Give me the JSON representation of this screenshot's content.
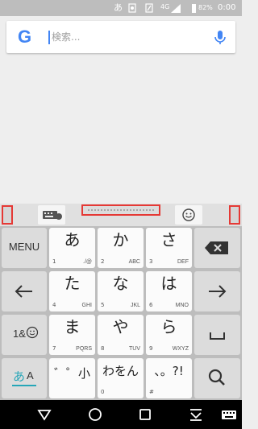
{
  "status_bar": {
    "ime_indicator": "あ",
    "network": "4G",
    "battery": "82%",
    "time": "0:00"
  },
  "search": {
    "logo_letter": "G",
    "placeholder": "検索..."
  },
  "keyboard": {
    "menu_label": "MENU",
    "symbols_label": "1&",
    "mode_label_kana": "あ",
    "mode_label_alpha": "A",
    "rows": [
      [
        {
          "main": "あ",
          "num": "1",
          "sub": "./@"
        },
        {
          "main": "か",
          "num": "2",
          "sub": "ABC"
        },
        {
          "main": "さ",
          "num": "3",
          "sub": "DEF"
        }
      ],
      [
        {
          "main": "た",
          "num": "4",
          "sub": "GHI"
        },
        {
          "main": "な",
          "num": "5",
          "sub": "JKL"
        },
        {
          "main": "は",
          "num": "6",
          "sub": "MNO"
        }
      ],
      [
        {
          "main": "ま",
          "num": "7",
          "sub": "PQRS"
        },
        {
          "main": "や",
          "num": "8",
          "sub": "TUV"
        },
        {
          "main": "ら",
          "num": "9",
          "sub": "WXYZ"
        }
      ],
      [
        {
          "main": "゛゜小",
          "num": "",
          "sub": ""
        },
        {
          "main": "わをん",
          "num": "0",
          "sub": ""
        },
        {
          "main": "、。?!",
          "num": "#",
          "sub": ""
        }
      ]
    ]
  },
  "icons": {
    "signal": "signal-icon",
    "battery": "battery-icon",
    "mic": "mic-icon",
    "keyboard_switch": "keyboard-switch-icon",
    "emoji": "emoji-icon",
    "backspace": "backspace-icon",
    "arrow_left": "arrow-left-icon",
    "arrow_right": "arrow-right-icon",
    "space": "space-icon",
    "search": "search-icon"
  },
  "colors": {
    "google_blue": "#4285f4",
    "highlight_border": "#e53935",
    "mode_underline": "#26a6b8"
  }
}
